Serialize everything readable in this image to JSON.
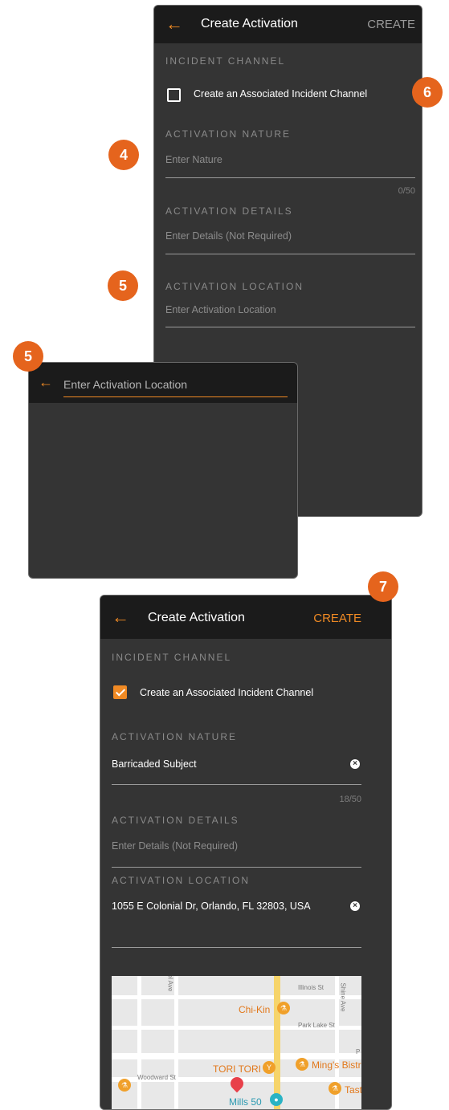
{
  "screen1": {
    "title": "Create Activation",
    "create_label": "CREATE",
    "incident_section": "INCIDENT CHANNEL",
    "checkbox_label": "Create an Associated Incident Channel",
    "nature_section": "ACTIVATION NATURE",
    "nature_placeholder": "Enter Nature",
    "nature_counter": "0/50",
    "details_section": "ACTIVATION DETAILS",
    "details_placeholder": "Enter Details (Not Required)",
    "location_section": "ACTIVATION LOCATION",
    "location_placeholder": "Enter Activation Location"
  },
  "screen2": {
    "search_placeholder": "Enter Activation Location"
  },
  "screen3": {
    "title": "Create Activation",
    "create_label": "CREATE",
    "incident_section": "INCIDENT CHANNEL",
    "checkbox_label": "Create an Associated Incident Channel",
    "nature_section": "ACTIVATION NATURE",
    "nature_value": "Barricaded Subject",
    "nature_counter": "18/50",
    "details_section": "ACTIVATION DETAILS",
    "details_placeholder": "Enter Details (Not Required)",
    "location_section": "ACTIVATION LOCATION",
    "location_value": "1055 E Colonial Dr, Orlando, FL 32803, USA",
    "map": {
      "streets": [
        "Illinois St",
        "Park Lake St",
        "Woodward St",
        "Shine Ave",
        "el Ave",
        "P"
      ],
      "pois": [
        "Chi-Kin",
        "TORI TORI",
        "Ming's Bistr",
        "Tast",
        "Mills 50"
      ]
    }
  },
  "badges": [
    "4",
    "5",
    "5",
    "6",
    "7"
  ],
  "colors": {
    "accent": "#f08a24",
    "badge": "#e5641d",
    "panel": "#343434",
    "bar": "#1b1b1b"
  },
  "icons": {
    "back": "arrow-left-icon",
    "clear": "clear-x-icon",
    "pin": "map-pin-icon",
    "food": "fork-knife-icon"
  }
}
